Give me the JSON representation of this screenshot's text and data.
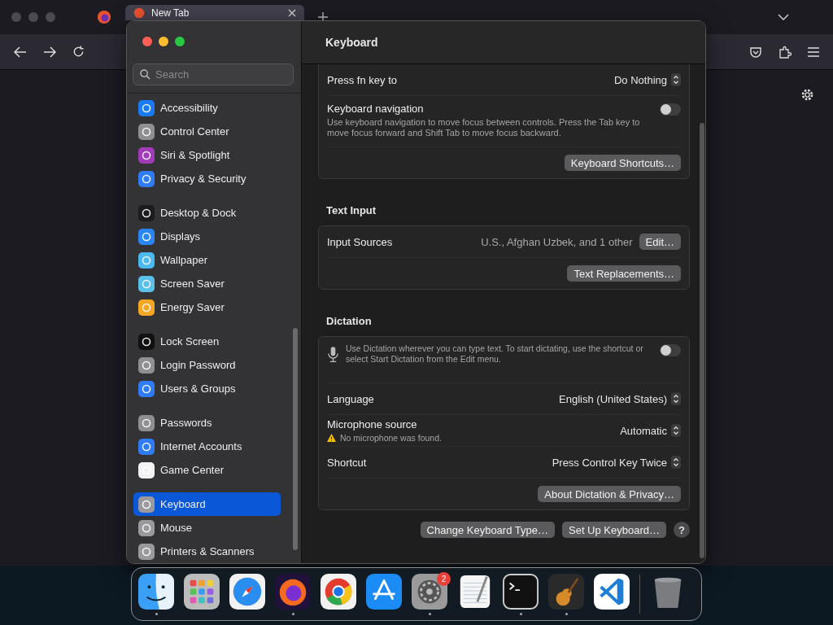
{
  "browser": {
    "tabs": [
      {
        "title": "New Tab",
        "selected": true
      }
    ]
  },
  "settings": {
    "title": "Keyboard",
    "search": {
      "placeholder": "Search"
    },
    "sidebar": {
      "groups": [
        [
          {
            "label": "Accessibility",
            "color": "#1a7cf5",
            "selected": false
          },
          {
            "label": "Control Center",
            "color": "#8e8e93",
            "selected": false
          },
          {
            "label": "Siri & Spotlight",
            "color": "#a23bb8",
            "selected": false
          },
          {
            "label": "Privacy & Security",
            "color": "#2f7cf6",
            "selected": false
          }
        ],
        [
          {
            "label": "Desktop & Dock",
            "color": "#1c1c1e",
            "selected": false
          },
          {
            "label": "Displays",
            "color": "#2b86f5",
            "selected": false
          },
          {
            "label": "Wallpaper",
            "color": "#4cb8f0",
            "selected": false
          },
          {
            "label": "Screen Saver",
            "color": "#5ac0ea",
            "selected": false
          },
          {
            "label": "Energy Saver",
            "color": "#f5a623",
            "selected": false
          }
        ],
        [
          {
            "label": "Lock Screen",
            "color": "#111111",
            "selected": false
          },
          {
            "label": "Login Password",
            "color": "#8e8e93",
            "selected": false
          },
          {
            "label": "Users & Groups",
            "color": "#2f7cf6",
            "selected": false
          }
        ],
        [
          {
            "label": "Passwords",
            "color": "#8e8e93",
            "selected": false
          },
          {
            "label": "Internet Accounts",
            "color": "#2f7cf6",
            "selected": false
          },
          {
            "label": "Game Center",
            "color": "#f2f2f2",
            "selected": false
          }
        ],
        [
          {
            "label": "Keyboard",
            "color": "#9a9a9e",
            "selected": true
          },
          {
            "label": "Mouse",
            "color": "#9a9a9e",
            "selected": false
          },
          {
            "label": "Printers & Scanners",
            "color": "#9a9a9e",
            "selected": false
          }
        ]
      ]
    },
    "sections": [
      {
        "rows": [
          {
            "kind": "popup",
            "label": "Press fn key to",
            "value": "Do Nothing"
          },
          {
            "kind": "toggle",
            "label": "Keyboard navigation",
            "description": "Use keyboard navigation to move focus between controls. Press the Tab key to move focus forward and Shift Tab to move focus backward.",
            "on": false
          },
          {
            "kind": "button",
            "button": "Keyboard Shortcuts…"
          }
        ]
      },
      {
        "heading": "Text Input",
        "rows": [
          {
            "kind": "value-button",
            "label": "Input Sources",
            "value": "U.S., Afghan Uzbek, and 1 other",
            "button": "Edit…"
          },
          {
            "kind": "button",
            "button": "Text Replacements…"
          }
        ]
      },
      {
        "heading": "Dictation",
        "rows": [
          {
            "kind": "mic-toggle",
            "description": "Use Dictation wherever you can type text. To start dictating, use the shortcut or select Start Dictation from the Edit menu.",
            "on": false
          },
          {
            "kind": "popup",
            "label": "Language",
            "value": "English (United States)"
          },
          {
            "kind": "popup",
            "label": "Microphone source",
            "value": "Automatic",
            "warning": "No microphone was found."
          },
          {
            "kind": "popup",
            "label": "Shortcut",
            "value": "Press Control Key Twice"
          },
          {
            "kind": "button",
            "button": "About Dictation & Privacy…"
          }
        ]
      }
    ],
    "footer_buttons": [
      "Change Keyboard Type…",
      "Set Up Keyboard…"
    ],
    "help": "?"
  },
  "dock": [
    {
      "kind": "finder",
      "running": true
    },
    {
      "kind": "launchpad",
      "running": false
    },
    {
      "kind": "safari",
      "running": false
    },
    {
      "kind": "firefox",
      "running": true
    },
    {
      "kind": "chrome",
      "running": false
    },
    {
      "kind": "appstore",
      "running": false
    },
    {
      "kind": "settings",
      "running": true,
      "badge": "2"
    },
    {
      "kind": "textedit",
      "running": false
    },
    {
      "kind": "terminal",
      "running": true
    },
    {
      "kind": "garageband",
      "running": true
    },
    {
      "kind": "vscode",
      "running": false
    },
    {
      "kind": "trash",
      "running": false
    }
  ]
}
